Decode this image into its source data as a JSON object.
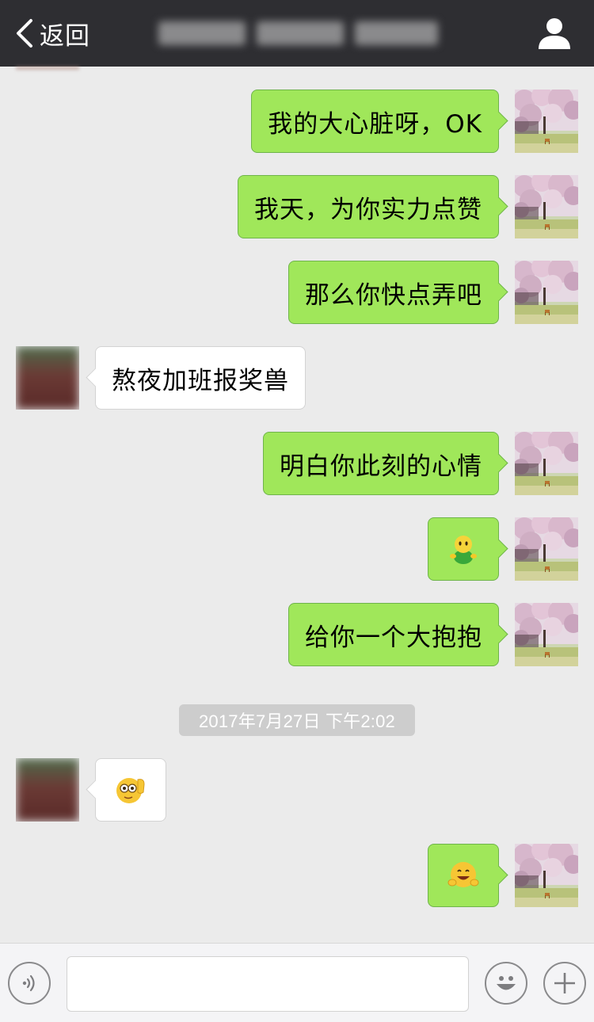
{
  "nav": {
    "back_label": "返回",
    "title": ""
  },
  "messages": [
    {
      "side": "right",
      "text": "我的大心脏呀，OK"
    },
    {
      "side": "right",
      "text": "我天，为你实力点赞"
    },
    {
      "side": "right",
      "text": "那么你快点弄吧"
    },
    {
      "side": "left",
      "text": "熬夜加班报奖兽"
    },
    {
      "side": "right",
      "text": "明白你此刻的心情"
    },
    {
      "side": "right",
      "sticker": "green-figure-emoji"
    },
    {
      "side": "right",
      "text": "给你一个大抱抱"
    },
    {
      "side": "left",
      "sticker": "thinking-wave-emoji"
    },
    {
      "side": "right",
      "sticker": "hugging-emoji"
    }
  ],
  "timestamp": "2017年7月27日 下午2:02",
  "input_bar": {
    "voice_icon": "voice-icon",
    "emoji_icon": "emoji-icon",
    "plus_icon": "plus-icon",
    "text_value": ""
  },
  "colors": {
    "nav_bg": "#2e2e32",
    "chat_bg": "#ebebeb",
    "sent_bubble": "#a0e75a",
    "received_bubble": "#ffffff"
  }
}
